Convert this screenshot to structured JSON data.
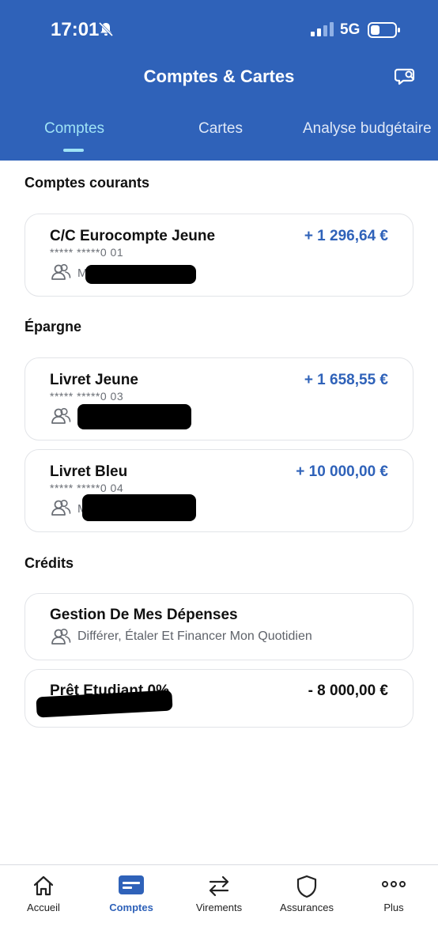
{
  "status_bar": {
    "time": "17:01",
    "network": "5G"
  },
  "header": {
    "title": "Comptes & Cartes",
    "tabs": [
      {
        "label": "Comptes",
        "active": true
      },
      {
        "label": "Cartes"
      },
      {
        "label": "Analyse budgétaire"
      }
    ]
  },
  "sections": {
    "courants": "Comptes courants",
    "epargne": "Épargne",
    "credits": "Crédits"
  },
  "accounts": {
    "cc": {
      "name": "C/C Eurocompte Jeune",
      "number": "***** *****0 01",
      "owner_initial": "M",
      "amount": "+ 1 296,64 €"
    },
    "livret_jeune": {
      "name": "Livret Jeune",
      "number": "***** *****0 03",
      "amount": "+ 1 658,55 €"
    },
    "livret_bleu": {
      "name": "Livret Bleu",
      "number": "***** *****0 04",
      "owner_initial": "M",
      "amount": "+ 10 000,00 €"
    },
    "gestion": {
      "name": "Gestion De Mes Dépenses",
      "subtitle": "Différer, Étaler Et Financer Mon Quotidien"
    },
    "pret": {
      "name": "Prêt Etudiant 0%",
      "amount": "- 8 000,00 €"
    }
  },
  "bottom_nav": [
    {
      "label": "Accueil",
      "icon": "home-icon"
    },
    {
      "label": "Comptes",
      "icon": "card-icon",
      "active": true
    },
    {
      "label": "Virements",
      "icon": "transfer-icon"
    },
    {
      "label": "Assurances",
      "icon": "shield-icon"
    },
    {
      "label": "Plus",
      "icon": "more-icon"
    }
  ],
  "colors": {
    "brand": "#2f62b9",
    "active_tab": "#9fe3f6",
    "amount_positive": "#2f62b9"
  }
}
